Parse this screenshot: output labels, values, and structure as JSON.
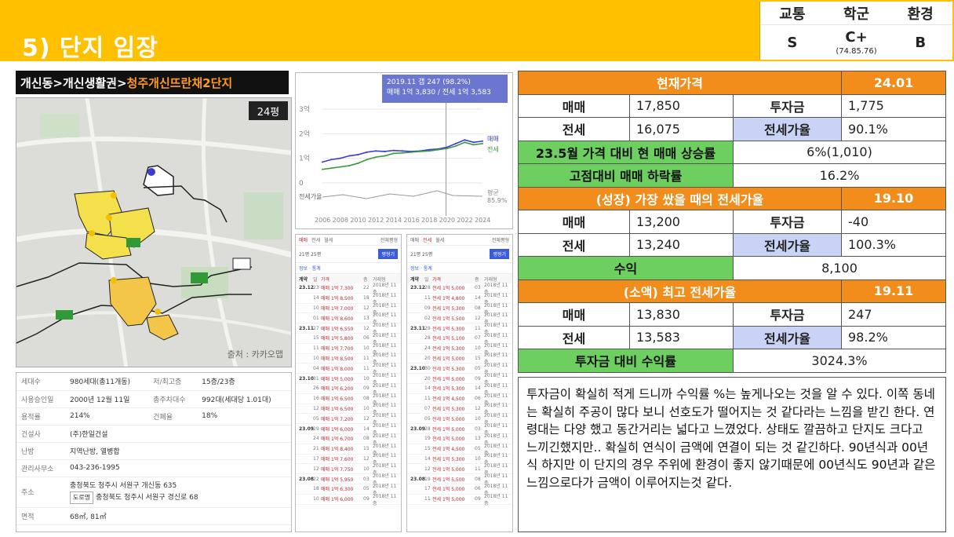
{
  "header": {
    "title": "5) 단지 임장",
    "grades": [
      {
        "label": "교통",
        "value": "S",
        "sub": ""
      },
      {
        "label": "학군",
        "value": "C+",
        "sub": "(74.85.76)"
      },
      {
        "label": "환경",
        "value": "B",
        "sub": ""
      }
    ]
  },
  "breadcrumb": {
    "path": "개신동>개신생활권>",
    "complex": "청주개신뜨란채2단지"
  },
  "map": {
    "pyeong": "24평",
    "credit": "출처 : 카카오맵"
  },
  "info": {
    "rows": [
      {
        "k1": "세대수",
        "v1": "980세대(총11개동)",
        "k2": "저/최고층",
        "v2": "15층/23층"
      },
      {
        "k1": "사용승인일",
        "v1": "2000년 12월 11일",
        "k2": "총주차대수",
        "v2": "992대(세대당 1.01대)"
      },
      {
        "k1": "용적률",
        "v1": "214%",
        "k2": "건폐율",
        "v2": "18%"
      },
      {
        "k1": "건설사",
        "v1": "(주)한일건설",
        "k2": "",
        "v2": ""
      },
      {
        "k1": "난방",
        "v1": "지역난방, 열병합",
        "k2": "",
        "v2": ""
      },
      {
        "k1": "관리사무소",
        "v1": "043-236-1995",
        "k2": "",
        "v2": ""
      }
    ],
    "address_label": "주소",
    "address_jibun": "충청북도 청주시 서원구 개신동 635",
    "road_tag": "도로명",
    "address_road": "충청북도 청주시 서원구 경신로 68",
    "area_label": "면적",
    "area_value": "68㎡, 81㎡"
  },
  "chart_data": {
    "type": "line",
    "tooltip_title": "2019.11 갭 247 (98.2%)",
    "tooltip_body": "매매 1억 3,830 / 전세 1억 3,583",
    "y_ticks": [
      "3억",
      "2억",
      "1억",
      "0"
    ],
    "ylim": [
      0,
      3
    ],
    "x_ticks": [
      "2006",
      "2008",
      "2010",
      "2012",
      "2014",
      "2016",
      "2018",
      "2020",
      "2022",
      "2024"
    ],
    "series": [
      {
        "name": "매매",
        "color": "#3b3bd6",
        "x": [
          2006,
          2007,
          2008,
          2009,
          2010,
          2011,
          2012,
          2013,
          2014,
          2015,
          2016,
          2017,
          2018,
          2019,
          2020,
          2021,
          2022,
          2023,
          2024
        ],
        "values": [
          0.85,
          0.95,
          1.0,
          1.1,
          1.15,
          1.25,
          1.3,
          1.28,
          1.32,
          1.3,
          1.28,
          1.3,
          1.35,
          1.38,
          1.45,
          1.6,
          1.75,
          1.65,
          1.7
        ]
      },
      {
        "name": "전세",
        "color": "#3c9a3c",
        "x": [
          2006,
          2007,
          2008,
          2009,
          2010,
          2011,
          2012,
          2013,
          2014,
          2015,
          2016,
          2017,
          2018,
          2019,
          2020,
          2021,
          2022,
          2023,
          2024
        ],
        "values": [
          0.55,
          0.6,
          0.65,
          0.7,
          0.8,
          0.95,
          1.05,
          1.1,
          1.2,
          1.22,
          1.25,
          1.28,
          1.3,
          1.35,
          1.4,
          1.5,
          1.65,
          1.55,
          1.6
        ]
      }
    ],
    "ratio_label": "전세가율",
    "ratio_end": "85.9%",
    "ratio_name": "평균"
  },
  "lists": [
    {
      "tabs": [
        "매매",
        "전세",
        "월세"
      ],
      "region": "전체평형",
      "opts": "21평  25평",
      "btn": "평형기",
      "filter": "정보 · 통계",
      "head": [
        "계약",
        "일",
        "동",
        "가격",
        "층",
        "거래형",
        "층"
      ],
      "rows": [
        [
          "23.12",
          "23",
          "매매 1억 7,300",
          "22",
          "2018년 11층"
        ],
        [
          "",
          "14",
          "매매 1억 8,500",
          "18",
          "2018년 11층"
        ],
        [
          "",
          "10",
          "매매 1억 7,000",
          "12",
          "2018년 11층"
        ],
        [
          "",
          "01",
          "매매 1억 8,600",
          "13",
          "2018년 11층"
        ],
        [
          "23.11",
          "27",
          "매매 1억 6,550",
          "12",
          "2018년 11층"
        ],
        [
          "",
          "15",
          "매매 1억 5,800",
          "06",
          "2018년 11층"
        ],
        [
          "",
          "11",
          "매매 1억 7,700",
          "10",
          "2018년 11층"
        ],
        [
          "",
          "10",
          "매매 1억 8,500",
          "11",
          "2018년 11층"
        ],
        [
          "",
          "04",
          "매매 1억 8,000",
          "11",
          "2018년 11층"
        ],
        [
          "23.10",
          "31",
          "매매 1억 5,000",
          "10",
          "2018년 11층"
        ],
        [
          "",
          "26",
          "매매 1억 6,200",
          "09",
          "2018년 11층"
        ],
        [
          "",
          "16",
          "매매 1억 6,500",
          "08",
          "2018년 11층"
        ],
        [
          "",
          "12",
          "매매 1억 6,500",
          "10",
          "2018년 11층"
        ],
        [
          "",
          "05",
          "매매 1억 7,200",
          "12",
          "2018년 11층"
        ],
        [
          "23.09",
          "29",
          "매매 1억 6,000",
          "14",
          "2018년 11층"
        ],
        [
          "",
          "24",
          "매매 1억 6,700",
          "08",
          "2018년 11층"
        ],
        [
          "",
          "21",
          "매매 1억 8,400",
          "15",
          "2018년 11층"
        ],
        [
          "",
          "17",
          "매매 1억 7,600",
          "12",
          "2018년 11층"
        ],
        [
          "",
          "12",
          "매매 1억 7,750",
          "10",
          "2018년 11층"
        ],
        [
          "23.08",
          "22",
          "매매 1억 5,950",
          "03",
          "2018년 11층"
        ],
        [
          "",
          "18",
          "매매 1억 6,300",
          "05",
          "2018년 11층"
        ],
        [
          "",
          "10",
          "매매 1억 6,000",
          "09",
          "2018년 11층"
        ]
      ]
    },
    {
      "tabs": [
        "매매",
        "전세",
        "월세"
      ],
      "region": "전체평형",
      "opts": "21평  25평",
      "btn": "평형기",
      "filter": "정보 · 통계",
      "head": [
        "계약",
        "일",
        "동",
        "가격",
        "층",
        "거래형",
        "층"
      ],
      "rows": [
        [
          "23.12",
          "28",
          "전세 1억 5,000",
          "03",
          "2018년 11층"
        ],
        [
          "",
          "11",
          "전세 1억 4,800",
          "14",
          "2018년 11층"
        ],
        [
          "",
          "09",
          "전세 1억 5,300",
          "08",
          "2018년 11층"
        ],
        [
          "",
          "02",
          "전세 1억 5,500",
          "12",
          "2018년 11층"
        ],
        [
          "23.11",
          "29",
          "전세 1억 5,300",
          "11",
          "2018년 11층"
        ],
        [
          "",
          "28",
          "전세 1억 5,100",
          "07",
          "2018년 11층"
        ],
        [
          "",
          "24",
          "전세 1억 5,300",
          "10",
          "2018년 11층"
        ],
        [
          "",
          "20",
          "전세 1억 5,000",
          "15",
          "2018년 11층"
        ],
        [
          "23.10",
          "30",
          "전세 1억 5,300",
          "05",
          "2018년 11층"
        ],
        [
          "",
          "20",
          "전세 1억 5,000",
          "09",
          "2018년 11층"
        ],
        [
          "",
          "14",
          "전세 1억 5,300",
          "14",
          "2018년 11층"
        ],
        [
          "",
          "11",
          "전세 1억 4,500",
          "06",
          "2018년 11층"
        ],
        [
          "",
          "07",
          "전세 1억 5,300",
          "12",
          "2018년 11층"
        ],
        [
          "",
          "05",
          "전세 1억 5,000",
          "10",
          "2018년 11층"
        ],
        [
          "23.09",
          "28",
          "전세 1억 5,000",
          "03",
          "2018년 11층"
        ],
        [
          "",
          "19",
          "전세 1억 5,000",
          "13",
          "2018년 11층"
        ],
        [
          "",
          "15",
          "전세 1억 4,500",
          "05",
          "2018년 11층"
        ],
        [
          "",
          "14",
          "전세 1억 5,300",
          "10",
          "2018년 11층"
        ],
        [
          "",
          "12",
          "전세 1억 5,000",
          "11",
          "2018년 11층"
        ],
        [
          "23.08",
          "19",
          "전세 1억 5,500",
          "08",
          "2018년 11층"
        ],
        [
          "",
          "17",
          "전세 1억 5,000",
          "06",
          "2018년 11층"
        ],
        [
          "",
          "11",
          "전세 1억 5,000",
          "09",
          "2018년 11층"
        ]
      ]
    }
  ],
  "price": {
    "current_label": "현재가격",
    "current_date": "24.01",
    "sale_label": "매매",
    "sale": "17,850",
    "invest_label": "투자금",
    "invest": "1,775",
    "jeonse_label": "전세",
    "jeonse": "16,075",
    "ratio_label": "전세가율",
    "ratio": "90.1%",
    "rise_label": "23.5월 가격 대비 현 매매 상승률",
    "rise": "6%(1,010)",
    "drop_label": "고점대비 매매 하락률",
    "drop": "16.2%",
    "peak_label": "(성장) 가장 쌌을 때의 전세가율",
    "peak_date": "19.10",
    "peak_sale": "13,200",
    "peak_invest": "-40",
    "peak_jeonse": "13,240",
    "peak_ratio": "100.3%",
    "profit_label": "수익",
    "profit": "8,100",
    "small_label": "(소액) 최고 전세가율",
    "small_date": "19.11",
    "small_sale": "13,830",
    "small_invest": "247",
    "small_jeonse": "13,583",
    "small_ratio": "98.2%",
    "return_label": "투자금 대비 수익률",
    "return": "3024.3%"
  },
  "comment": "투자금이 확실히 적게 드니까 수익률 %는 높게나오는 것을 알 수 있다. 이쪽 동네는 확실히 주공이 많다 보니 선호도가 떨어지는 것 같다라는 느낌을 받긴 한다.  연령대는 다양 했고 동간거리는 넓다고 느꼈었다. 상태도 깔끔하고 단지도 크다고 느끼긴했지만.. 확실히 연식이 금액에 연결이 되는 것 같긴하다. 90년식과 00년식 하지만 이 단지의 경우 주위에 환경이 좋지 않기때문에 00년식도 90년과 같은 느낌으로다가 금액이 이루어지는것 같다."
}
